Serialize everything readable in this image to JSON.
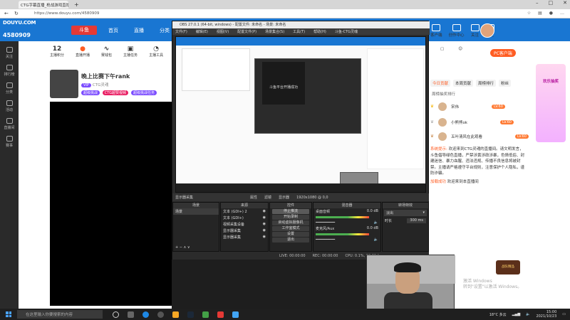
{
  "browser": {
    "tab_title": "CTG字幕直播_枪战游戏直播_斗鱼",
    "url": "https://www.douyu.com/4580909"
  },
  "douyu": {
    "logo": "DOUYU.COM",
    "room_no": "4580909",
    "brand": "斗鱼",
    "nav": [
      "首页",
      "直播",
      "分类"
    ],
    "right_icons": [
      "客户端",
      "创作中心",
      "关注",
      "历史"
    ],
    "stats": [
      {
        "num": "12",
        "label": "主播积分"
      },
      {
        "num": "",
        "label": "直播开播"
      },
      {
        "num": "",
        "label": "赛钱包"
      },
      {
        "num": "",
        "label": "主播任务"
      },
      {
        "num": "",
        "label": "主播工具"
      }
    ],
    "stream_title": "晚上比赛下午rank",
    "streamer": "CTG灵魂",
    "tags": [
      "VIP",
      "超级挑战",
      "CTG超赞视频",
      "超级挑战任务"
    ],
    "left_nav": [
      "关注",
      "排行榜",
      "分类",
      "活动",
      "直播间",
      "赛事"
    ],
    "pc_button": "PC客户端",
    "chat_tabs": [
      "今日贡献",
      "本周贡献",
      "周榜排行",
      "粉丝"
    ],
    "rank_title": "周榜抽奖排行",
    "rank": [
      {
        "name": "宋伟",
        "btn": "LV.60"
      },
      {
        "name": "小熊熊ok",
        "btn": "LV.60"
      },
      {
        "name": "五叶清风在此观看",
        "btn": "LV.60"
      }
    ],
    "notice_label": "系统提示:",
    "notice": "欢迎来到CTG灵魂的直播间。请文明发言，斗鱼倡导绿色直播，严禁涉黄涉政涉暴，色情低俗、封建迷信、暴力血腥、违法违规、传播不良信息将被封禁。主播请严格遵守平台规则，注意保护个人隐私，谨防诈骗。",
    "notice2_label": "加载成功",
    "notice2": "欢迎来到本直播间",
    "promo": "欢乐抽奖"
  },
  "obs": {
    "title": "OBS 27.0.1 (64-bit, windows) - 配置文件: 未命名 - 场景: 未命名",
    "menu": [
      "文件(F)",
      "编辑(E)",
      "视图(V)",
      "配置文件(P)",
      "场景集合(S)",
      "工具(T)",
      "帮助(H)",
      "斗鱼-CTG灵魂"
    ],
    "bar": [
      "显示器采集",
      "属性",
      "滤镜",
      "显示器",
      "1920x1080 @ 0,0"
    ],
    "scenes_header": "场景",
    "scene_item": "场景",
    "sources_header": "来源",
    "sources": [
      "文本 (GDI+) 2",
      "文本 (GDI+)",
      "视频采集设备",
      "显示器采集",
      "显示器采集"
    ],
    "mixer_header": "混音器",
    "mixer": [
      {
        "name": "桌面音频",
        "db": "0.0 dB"
      },
      {
        "name": "麦克风/Aux",
        "db": "0.0 dB"
      }
    ],
    "transitions_header": "转场特效",
    "transition": "淡出",
    "duration_label": "时长",
    "duration": "300 ms",
    "controls_header": "控件",
    "controls": [
      "停止推流",
      "开始录制",
      "启动虚拟摄像机",
      "工作室模式",
      "设置",
      "退出"
    ],
    "status": [
      "LIVE: 00:00:00",
      "REC: 00:00:00",
      "CPU: 0.1%, 60.00 fps"
    ],
    "preview_text": "斗鱼平台开播成功"
  },
  "windows": {
    "search_placeholder": "在这里输入你要搜索的内容",
    "weather": "18°C 多云",
    "time": "15:00",
    "date": "2021/10/23",
    "activate_title": "激活 Windows",
    "activate_sub": "转到\"设置\"以激活 Windows。",
    "watermark": "战队精品"
  },
  "colors": {
    "douyu_blue": "#1976d2",
    "douyu_orange": "#ff5d23",
    "obs_dark": "#2b2b2b"
  }
}
